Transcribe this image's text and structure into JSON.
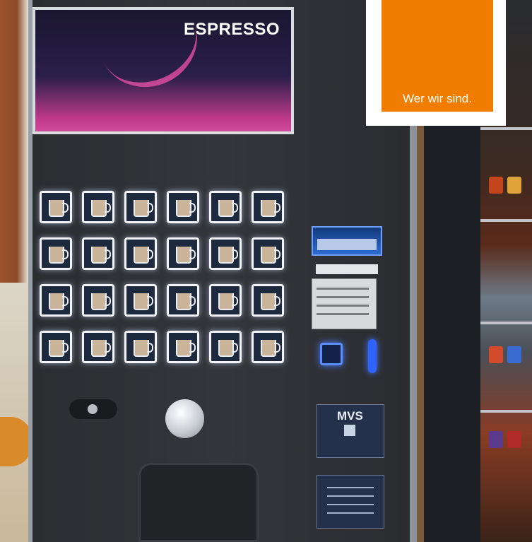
{
  "screen": {
    "brand": "ESPRESSO"
  },
  "panel": {
    "rows": 4,
    "cols": 6
  },
  "plaque": {
    "logo": "MVS"
  },
  "overlay": {
    "tagline": "Wer wir sind.",
    "color": "#f07d00"
  }
}
